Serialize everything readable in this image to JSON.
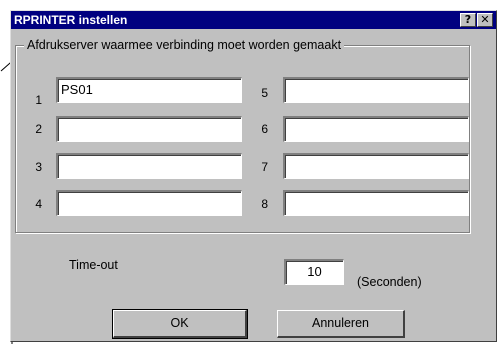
{
  "window": {
    "title": "RPRINTER instellen",
    "help_label": "?",
    "close_label": "✕"
  },
  "group": {
    "legend": "Afdrukserver waarmee verbinding moet worden gemaakt",
    "fields": [
      {
        "number": "1",
        "value": "PS01"
      },
      {
        "number": "2",
        "value": ""
      },
      {
        "number": "3",
        "value": ""
      },
      {
        "number": "4",
        "value": ""
      },
      {
        "number": "5",
        "value": ""
      },
      {
        "number": "6",
        "value": ""
      },
      {
        "number": "7",
        "value": ""
      },
      {
        "number": "8",
        "value": ""
      }
    ]
  },
  "timeout": {
    "label": "Time-out",
    "value": "10",
    "unit": "(Seconden)"
  },
  "buttons": {
    "ok": "OK",
    "cancel": "Annuleren"
  },
  "colors": {
    "titlebar": "#000080",
    "face": "#c0c0c0"
  }
}
